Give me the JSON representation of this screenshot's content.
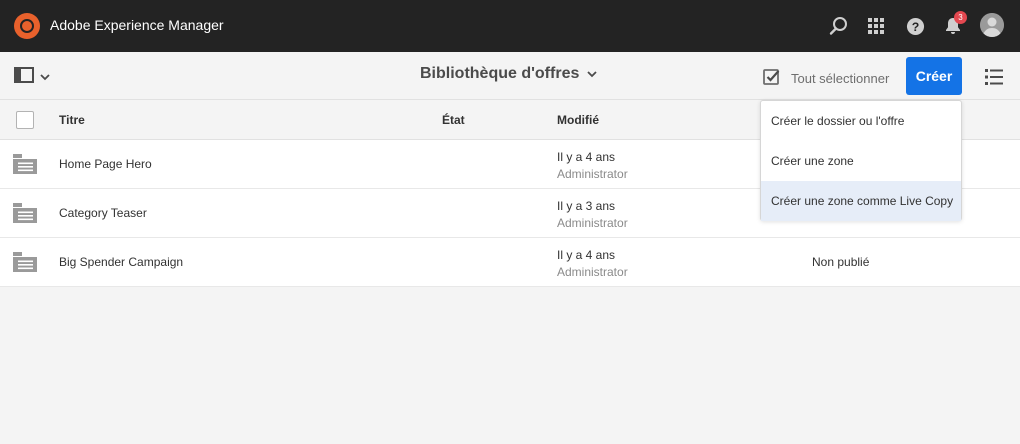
{
  "shell": {
    "app_title": "Adobe Experience Manager",
    "notification_count": "3",
    "icons": [
      "adobe-experience-manager-logo",
      "search-icon",
      "apps-grid-icon",
      "help-icon",
      "bell-icon",
      "user-avatar"
    ]
  },
  "actionbar": {
    "page_title": "Bibliothèque d'offres",
    "select_all_label": "Tout sélectionner",
    "create_label": "Créer",
    "icons": [
      "side-rail-icon",
      "chevron-down-icon",
      "checkbox-checked-icon",
      "list-view-icon"
    ]
  },
  "table": {
    "columns": [
      "Titre",
      "État",
      "Modifié"
    ],
    "rows": [
      {
        "title": "Home Page Hero",
        "modified_time": "Il y a 4 ans",
        "modified_by": "Administrator",
        "status": ""
      },
      {
        "title": "Category Teaser",
        "modified_time": "Il y a 3 ans",
        "modified_by": "Administrator",
        "status": ""
      },
      {
        "title": "Big Spender Campaign",
        "modified_time": "Il y a 4 ans",
        "modified_by": "Administrator",
        "status": "Non publié"
      }
    ]
  },
  "create_menu": {
    "items": [
      {
        "label": "Créer le dossier ou l'offre"
      },
      {
        "label": "Créer une zone"
      },
      {
        "label": "Créer une zone comme Live Copy",
        "highlighted": true
      }
    ]
  },
  "colors": {
    "shell": "#232323",
    "accent": "#1473e6",
    "logo": "#e8612c",
    "badge": "#e34850",
    "menu_highlight": "#e6edf8"
  }
}
